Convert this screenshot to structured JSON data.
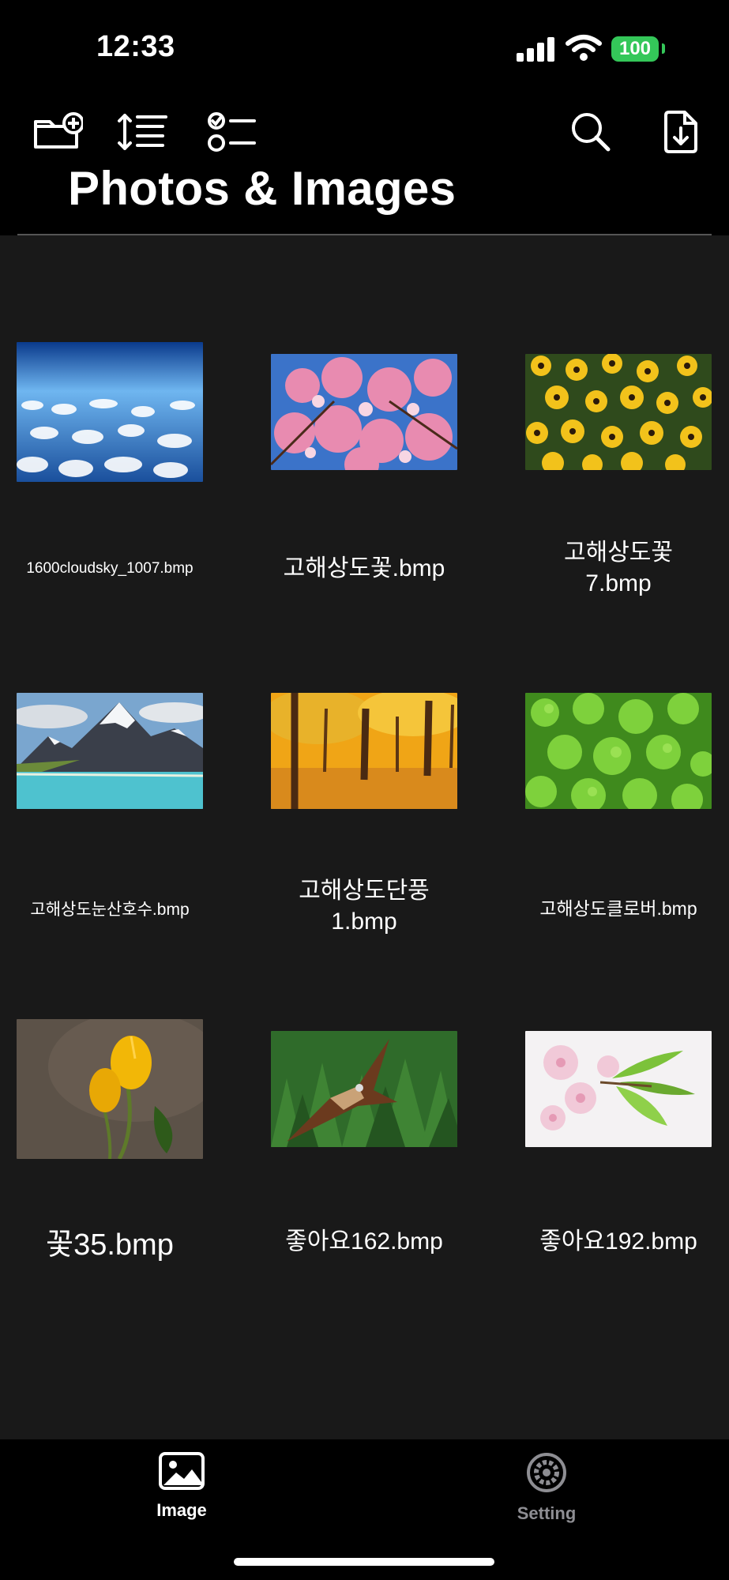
{
  "status_bar": {
    "time": "12:33",
    "battery": "100"
  },
  "toolbar": {
    "icons": [
      "new-folder-icon",
      "sort-icon",
      "select-icon",
      "search-icon",
      "import-file-icon"
    ]
  },
  "page": {
    "title": "Photos & Images"
  },
  "files": [
    {
      "name": "1600cloudsky_1007.bmp",
      "thumb": "sky-clouds"
    },
    {
      "name": "고해상도꽃.bmp",
      "thumb": "pink-blossoms"
    },
    {
      "name": "고해상도꽃\n7.bmp",
      "thumb": "yellow-flowers"
    },
    {
      "name": "고해상도눈산호수.bmp",
      "thumb": "snow-mountain-lake"
    },
    {
      "name": "고해상도단풍\n1.bmp",
      "thumb": "autumn-trees"
    },
    {
      "name": "고해상도클로버.bmp",
      "thumb": "clover"
    },
    {
      "name": "꽃35.bmp",
      "thumb": "yellow-tulips"
    },
    {
      "name": "좋아요162.bmp",
      "thumb": "hawk-forest"
    },
    {
      "name": "좋아요192.bmp",
      "thumb": "cherry-blossom"
    }
  ],
  "tabs": [
    {
      "label": "Image",
      "icon": "image-icon",
      "active": true
    },
    {
      "label": "Setting",
      "icon": "gear-icon",
      "active": false
    }
  ],
  "colors": {
    "background": "#191919",
    "bars": "#000000",
    "battery": "#34c759",
    "tab_active": "#ffffff",
    "tab_inactive": "#8e8e93"
  }
}
